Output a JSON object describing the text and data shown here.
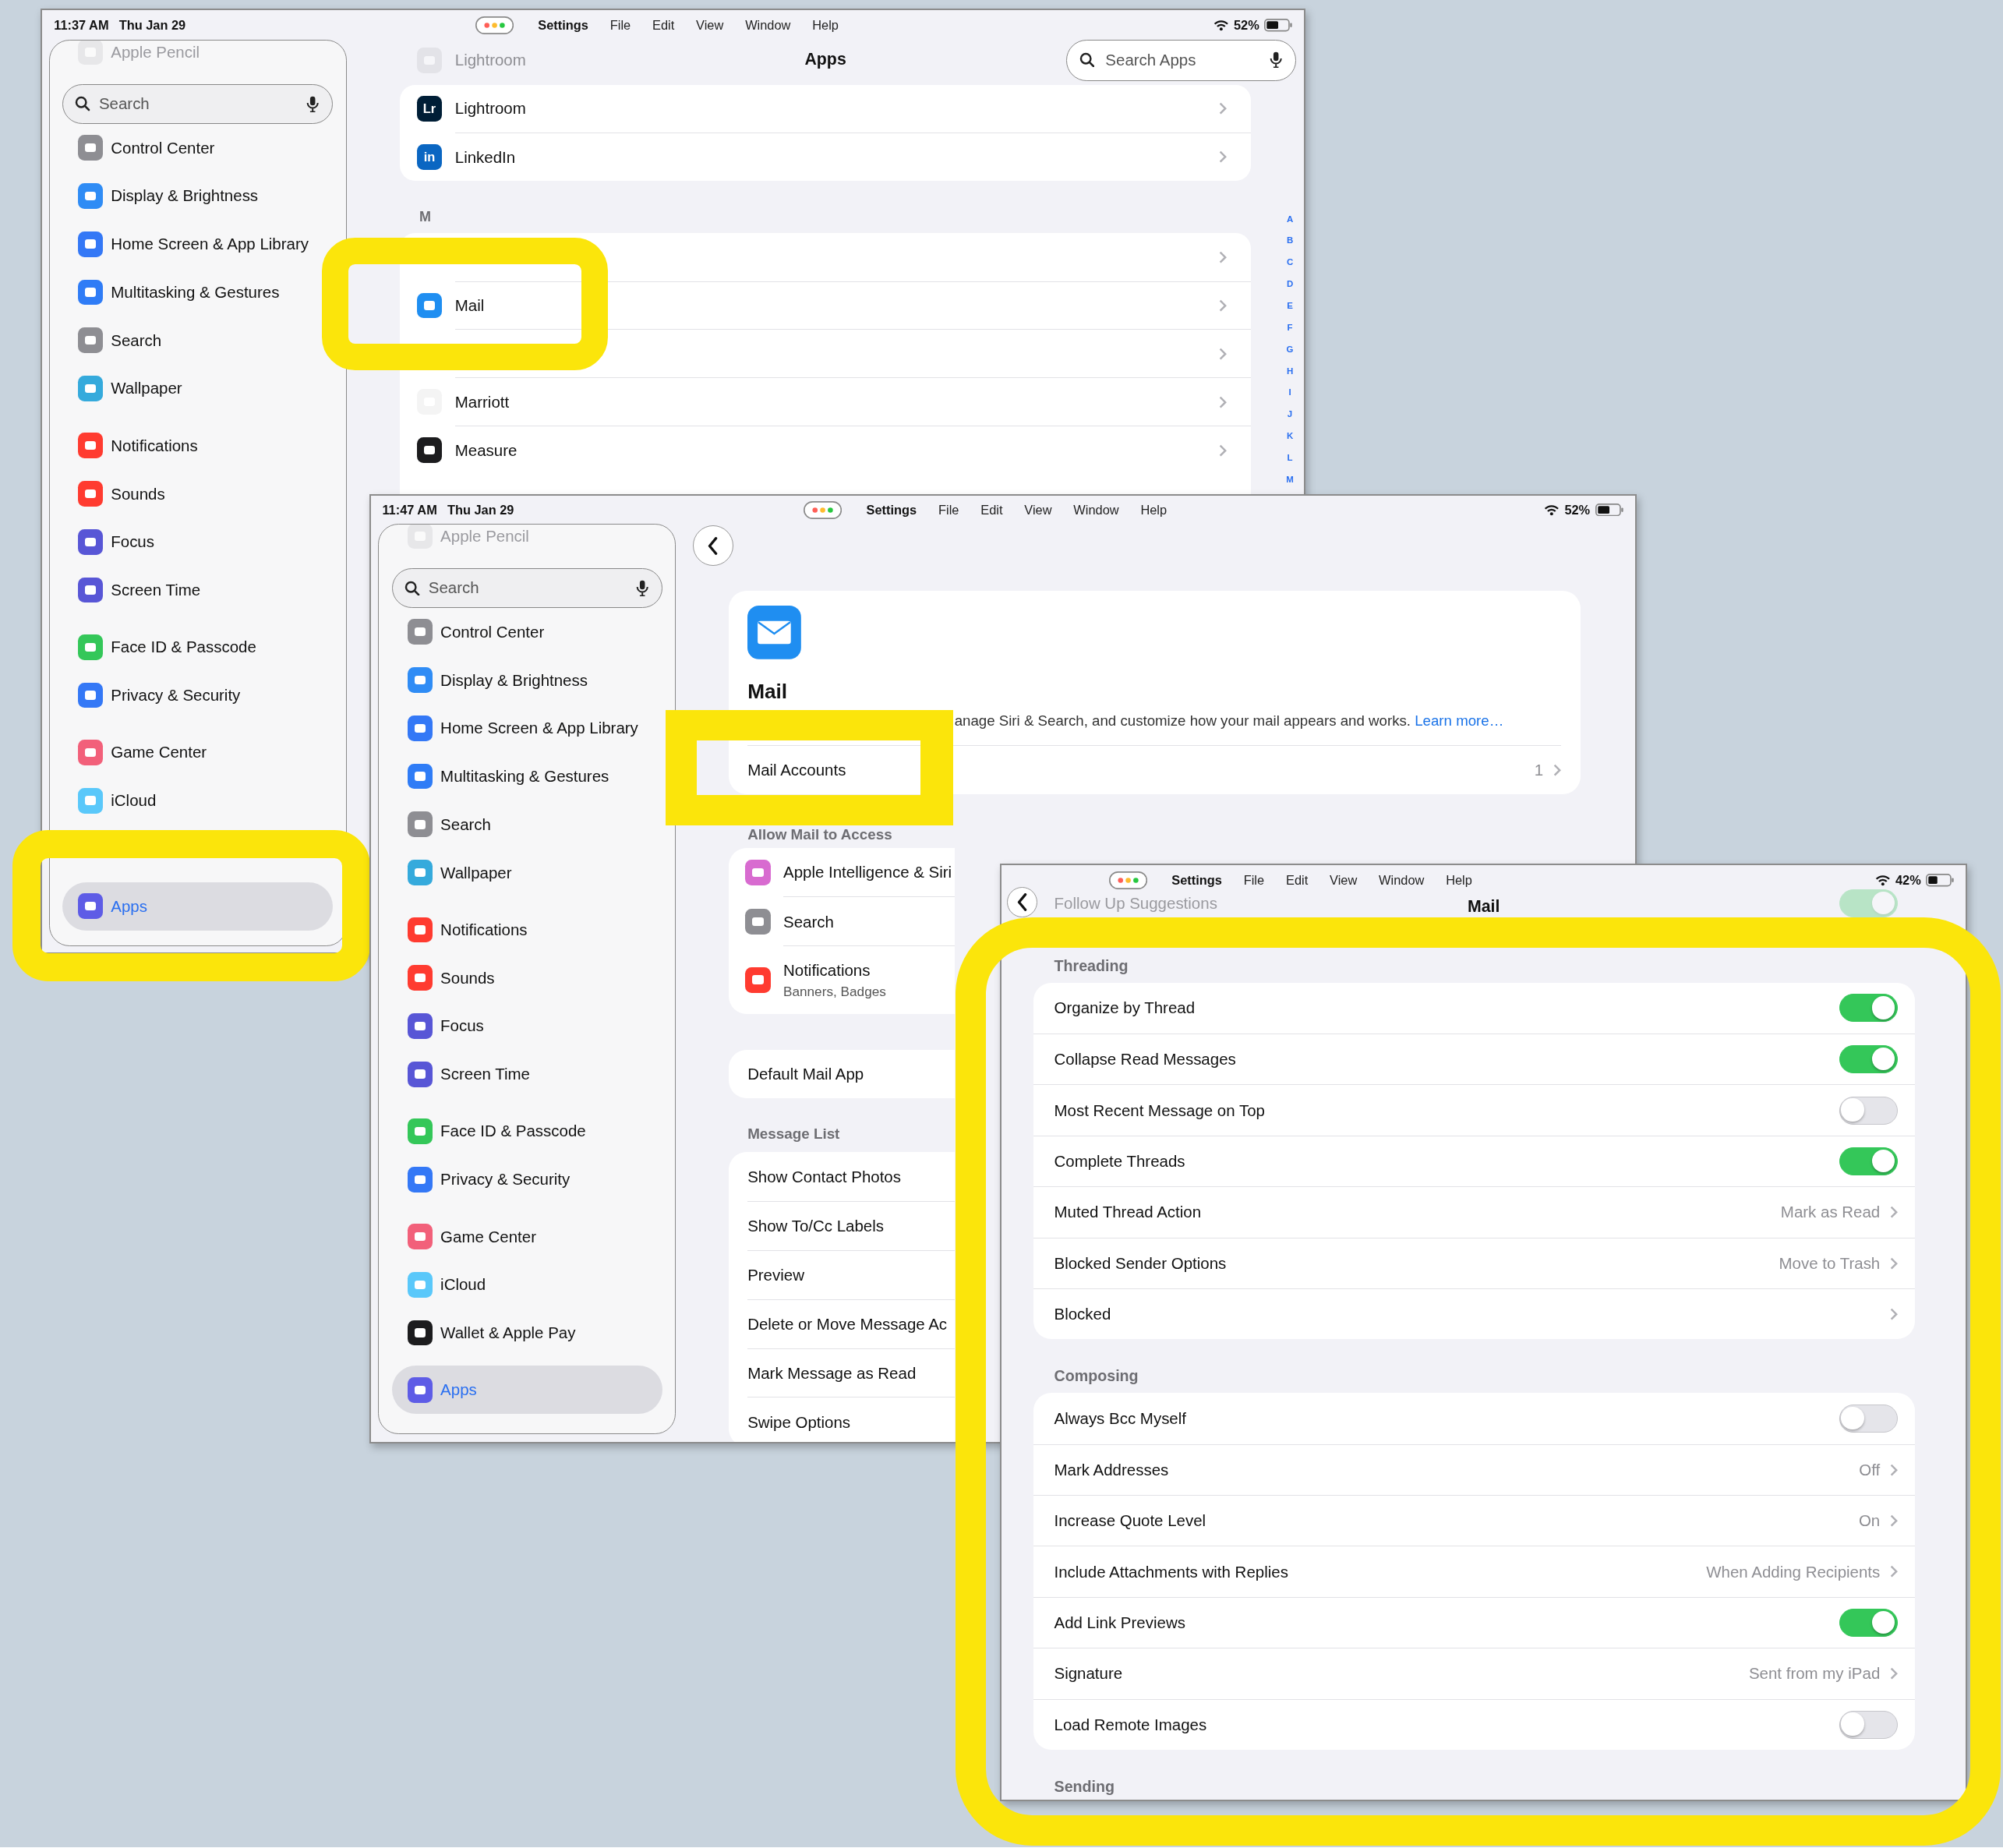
{
  "apps_window": {
    "status_bar": {
      "time": "11:37 AM",
      "date": "Thu Jan 29",
      "battery": "52%"
    },
    "menu": [
      "Settings",
      "File",
      "Edit",
      "View",
      "Window",
      "Help"
    ],
    "sidebar": {
      "faded_item": {
        "label": "Apple Pencil"
      },
      "search": {
        "placeholder": "Search"
      },
      "groups": [
        {
          "items": [
            {
              "label": "Control Center",
              "color": "#8e8e93",
              "selected": false
            },
            {
              "label": "Display & Brightness",
              "color": "#2f8cf5",
              "selected": false
            },
            {
              "label": "Home Screen & App Library",
              "color": "#3478f6",
              "selected": false
            },
            {
              "label": "Multitasking & Gestures",
              "color": "#2f7cf6",
              "selected": false
            },
            {
              "label": "Search",
              "color": "#8e8e93",
              "selected": false
            },
            {
              "label": "Wallpaper",
              "color": "#35aadc",
              "selected": false
            }
          ]
        },
        {
          "items": [
            {
              "label": "Notifications",
              "color": "#ff3b30",
              "selected": false
            },
            {
              "label": "Sounds",
              "color": "#ff3b30",
              "selected": false
            },
            {
              "label": "Focus",
              "color": "#5856d6",
              "selected": false
            },
            {
              "label": "Screen Time",
              "color": "#5856d6",
              "selected": false
            }
          ]
        },
        {
          "items": [
            {
              "label": "Face ID & Passcode",
              "color": "#34c759",
              "selected": false
            },
            {
              "label": "Privacy & Security",
              "color": "#3478f6",
              "selected": false
            }
          ]
        },
        {
          "items": [
            {
              "label": "Game Center",
              "color": "#f2607a",
              "selected": false
            },
            {
              "label": "iCloud",
              "color": "#5ac8fa",
              "selected": false
            }
          ]
        },
        {
          "items": [
            {
              "label": "Apps",
              "color": "#5e5ce6",
              "selected": true
            }
          ]
        }
      ]
    },
    "title": "Apps",
    "search": {
      "placeholder": "Search Apps"
    },
    "faded_row": {
      "label": "Lightroom"
    },
    "sections": [
      {
        "rows": [
          {
            "label": "Lightroom",
            "icon_text": "Lr",
            "color": "#001e36"
          },
          {
            "label": "LinkedIn",
            "icon_text": "in",
            "color": "#0a66c2"
          }
        ]
      },
      {
        "header": "M",
        "rows": [
          {},
          {
            "label": "Mail",
            "color": "#1f8ef1"
          },
          {},
          {
            "label": "Marriott",
            "color": "#f4f4f4"
          },
          {
            "label": "Measure",
            "color": "#1c1c1e"
          }
        ]
      }
    ],
    "index": [
      "A",
      "B",
      "C",
      "D",
      "E",
      "F",
      "G",
      "H",
      "I",
      "J",
      "K",
      "L",
      "M"
    ]
  },
  "mail_window": {
    "status_bar": {
      "time": "11:47 AM",
      "date": "Thu Jan 29",
      "battery": "52%"
    },
    "menu": [
      "Settings",
      "File",
      "Edit",
      "View",
      "Window",
      "Help"
    ],
    "sidebar": {
      "faded_item": {
        "label": "Apple Pencil"
      },
      "search": {
        "placeholder": "Search"
      },
      "groups": [
        {
          "items": [
            {
              "label": "Control Center",
              "color": "#8e8e93",
              "selected": false
            },
            {
              "label": "Display & Brightness",
              "color": "#2f8cf5",
              "selected": false
            },
            {
              "label": "Home Screen & App Library",
              "color": "#3478f6",
              "selected": false
            },
            {
              "label": "Multitasking & Gestures",
              "color": "#2f7cf6",
              "selected": false
            },
            {
              "label": "Search",
              "color": "#8e8e93",
              "selected": false
            },
            {
              "label": "Wallpaper",
              "color": "#35aadc",
              "selected": false
            }
          ]
        },
        {
          "items": [
            {
              "label": "Notifications",
              "color": "#ff3b30",
              "selected": false
            },
            {
              "label": "Sounds",
              "color": "#ff3b30",
              "selected": false
            },
            {
              "label": "Focus",
              "color": "#5856d6",
              "selected": false
            },
            {
              "label": "Screen Time",
              "color": "#5856d6",
              "selected": false
            }
          ]
        },
        {
          "items": [
            {
              "label": "Face ID & Passcode",
              "color": "#34c759",
              "selected": false
            },
            {
              "label": "Privacy & Security",
              "color": "#3478f6",
              "selected": false
            }
          ]
        },
        {
          "items": [
            {
              "label": "Game Center",
              "color": "#f2607a",
              "selected": false
            },
            {
              "label": "iCloud",
              "color": "#5ac8fa",
              "selected": false
            },
            {
              "label": "Wallet & Apple Pay",
              "color": "#1c1c1e",
              "selected": false
            }
          ]
        },
        {
          "items": [
            {
              "label": "Apps",
              "color": "#5e5ce6",
              "selected": true
            }
          ]
        }
      ]
    },
    "header_card": {
      "title": "Mail",
      "description": "anage Siri & Search, and customize how your mail appears and works.",
      "link": "Learn more…",
      "accounts_row": {
        "label": "Mail Accounts",
        "value": "1"
      }
    },
    "sections": [
      {
        "header": "Allow Mail to Access",
        "rows": [
          {
            "label": "Apple Intelligence & Siri",
            "color": "#d86bd0"
          },
          {
            "label": "Search",
            "color": "#8e8e93"
          },
          {
            "label": "Notifications",
            "subtitle": "Banners, Badges",
            "color": "#ff3b30"
          }
        ]
      },
      {
        "rows": [
          {
            "label": "Default Mail App"
          }
        ]
      },
      {
        "header": "Message List",
        "rows": [
          {
            "label": "Show Contact Photos"
          },
          {
            "label": "Show To/Cc Labels"
          },
          {
            "label": "Preview"
          },
          {
            "label": "Delete or Move Message Ac"
          },
          {
            "label": "Mark Message as Read"
          },
          {
            "label": "Swipe Options"
          }
        ]
      }
    ]
  },
  "mail_options_window": {
    "status_bar": {
      "battery": "42%"
    },
    "menu": [
      "Settings",
      "File",
      "Edit",
      "View",
      "Window",
      "Help"
    ],
    "faded_row": {
      "label": "Follow Up Suggestions",
      "on": true
    },
    "title": "Mail",
    "sections": [
      {
        "header": "Threading",
        "rows": [
          {
            "kind": "toggle",
            "label": "Organize by Thread",
            "on": true
          },
          {
            "kind": "toggle",
            "label": "Collapse Read Messages",
            "on": true
          },
          {
            "kind": "toggle",
            "label": "Most Recent Message on Top",
            "on": false
          },
          {
            "kind": "toggle",
            "label": "Complete Threads",
            "on": true
          },
          {
            "kind": "value",
            "label": "Muted Thread Action",
            "value": "Mark as Read"
          },
          {
            "kind": "value",
            "label": "Blocked Sender Options",
            "value": "Move to Trash"
          },
          {
            "kind": "link",
            "label": "Blocked"
          }
        ]
      },
      {
        "header": "Composing",
        "rows": [
          {
            "kind": "toggle",
            "label": "Always Bcc Myself",
            "on": false
          },
          {
            "kind": "value",
            "label": "Mark Addresses",
            "value": "Off"
          },
          {
            "kind": "value",
            "label": "Increase Quote Level",
            "value": "On"
          },
          {
            "kind": "value",
            "label": "Include Attachments with Replies",
            "value": "When Adding Recipients"
          },
          {
            "kind": "toggle",
            "label": "Add Link Previews",
            "on": true
          },
          {
            "kind": "value",
            "label": "Signature",
            "value": "Sent from my iPad"
          },
          {
            "kind": "toggle",
            "label": "Load Remote Images",
            "on": false
          }
        ]
      },
      {
        "header": "Sending"
      }
    ]
  }
}
